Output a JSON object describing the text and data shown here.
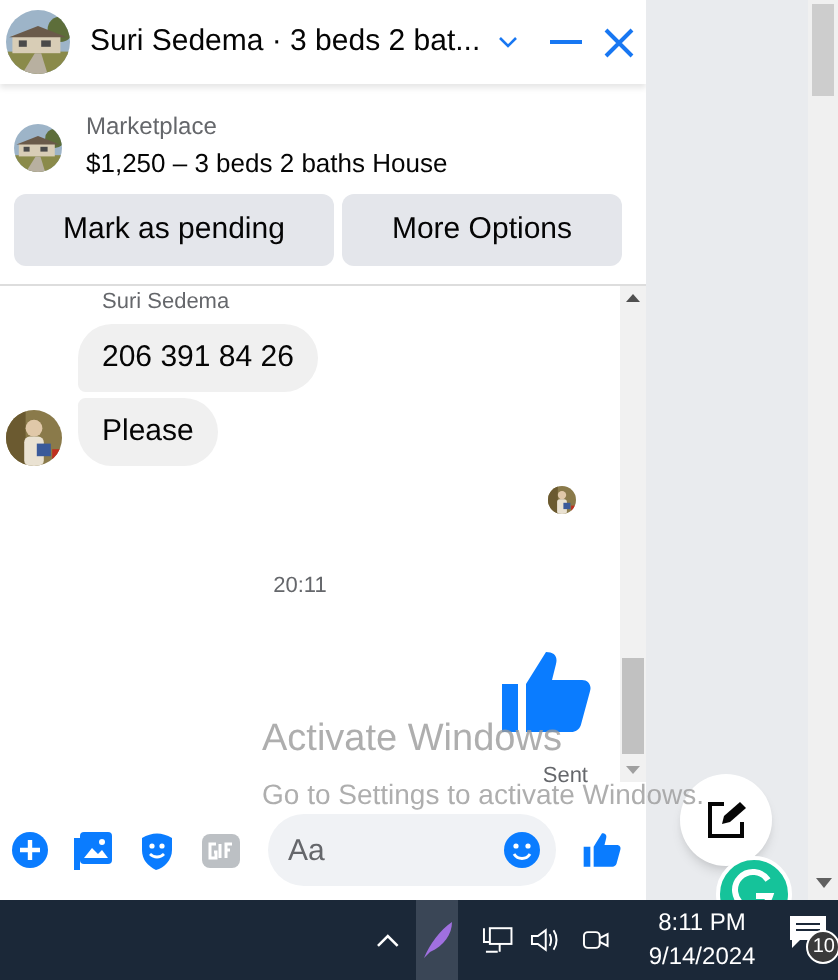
{
  "header": {
    "title": "Suri Sedema · 3 beds 2 bat..."
  },
  "listing": {
    "label": "Marketplace",
    "title": "$1,250 – 3 beds 2 baths House"
  },
  "actions": [
    "Mark as pending",
    "More Options"
  ],
  "conversation": {
    "sender": "Suri Sedema",
    "bubbles": [
      "206 391 84 26",
      "Please"
    ],
    "timestamp": "20:11",
    "sent_status": "Sent"
  },
  "composer": {
    "placeholder": "Aa"
  },
  "watermark": {
    "title": "Activate Windows",
    "subtitle": "Go to Settings to activate Windows."
  },
  "taskbar": {
    "time": "8:11 PM",
    "date": "9/14/2024",
    "notifications": "10"
  }
}
